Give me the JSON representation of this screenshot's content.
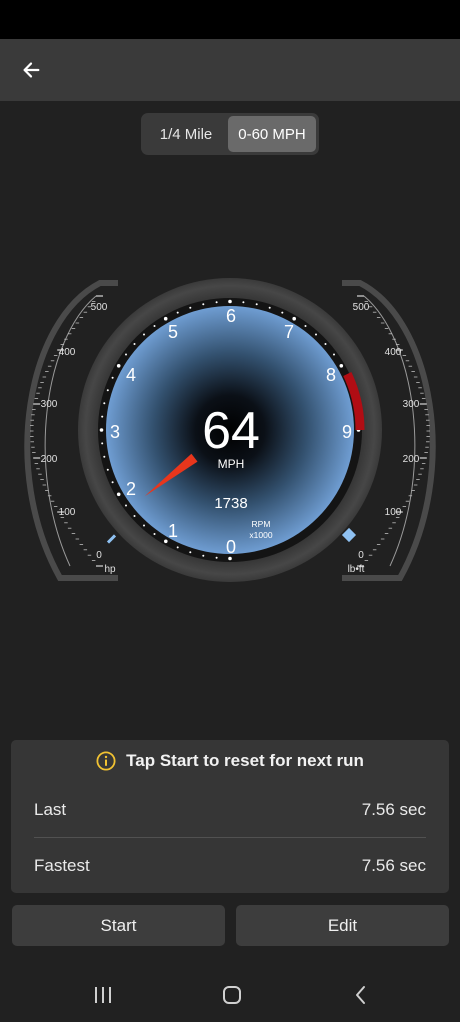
{
  "tabs": [
    {
      "label": "1/4 Mile",
      "active": false
    },
    {
      "label": "0-60 MPH",
      "active": true
    }
  ],
  "gauge": {
    "speed": "64",
    "speed_unit": "MPH",
    "rpm": "1738",
    "rpm_unit_1": "RPM",
    "rpm_unit_2": "x1000",
    "dial_numbers": [
      "0",
      "1",
      "2",
      "3",
      "4",
      "5",
      "6",
      "7",
      "8",
      "9"
    ],
    "needle_rpm_fraction": 0.1931,
    "left_scale": {
      "labels": [
        "500",
        "400",
        "300",
        "200",
        "100",
        "0"
      ],
      "unit": "hp",
      "level": 0
    },
    "right_scale": {
      "labels": [
        "500",
        "400",
        "300",
        "200",
        "100",
        "0"
      ],
      "unit": "lb•ft",
      "level": 0
    },
    "colors": {
      "dial": "#6f9dd2",
      "needle": "#e8361c",
      "redline": "#b00d14",
      "bezel": "#3a3a3a",
      "marker": "#8fc1f2"
    }
  },
  "panel": {
    "message": "Tap Start to reset for next run",
    "rows": [
      {
        "label": "Last",
        "value": "7.56 sec"
      },
      {
        "label": "Fastest",
        "value": "7.56 sec"
      }
    ]
  },
  "buttons": {
    "start": "Start",
    "edit": "Edit"
  },
  "icons": {
    "back": "arrow-left-icon",
    "info": "info-icon",
    "recents": "recents-icon",
    "home": "home-icon",
    "nav_back": "chevron-left-icon"
  }
}
